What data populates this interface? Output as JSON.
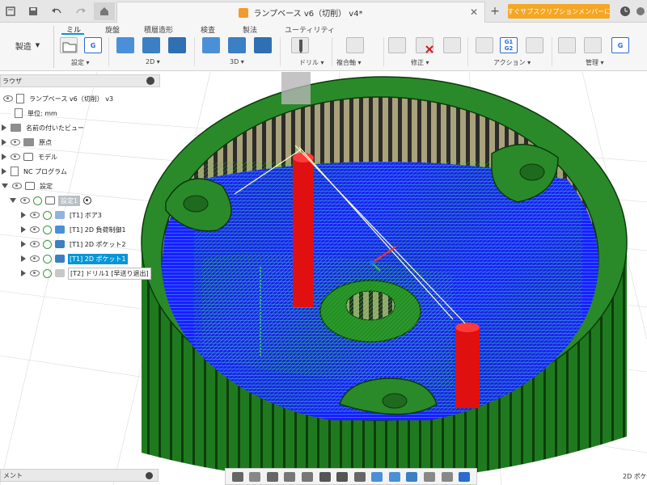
{
  "titlebar": {
    "document_title": "ランプベース v6（切削） v4*",
    "subscribe_label": "今すぐサブスクリプションメンバーに..."
  },
  "ribbon": {
    "workspace": "製造",
    "tabs": [
      {
        "label": "ミル",
        "active": true
      },
      {
        "label": "旋盤"
      },
      {
        "label": "積層造形"
      },
      {
        "label": "検査"
      },
      {
        "label": "製法"
      },
      {
        "label": "ユーティリティ"
      }
    ],
    "groups": [
      "設定",
      "2D",
      "3D",
      "ドリル",
      "複合軸",
      "修正",
      "アクション",
      "管理"
    ],
    "g_icon_labels": [
      "G",
      "G1",
      "G2"
    ]
  },
  "browser": {
    "title": "ラウザ",
    "items": [
      {
        "label": "ランプベース v6（切削） v3"
      },
      {
        "label": "単位: mm"
      },
      {
        "label": "名前の付いたビュー"
      },
      {
        "label": "原点"
      },
      {
        "label": "モデル"
      },
      {
        "label": "NC プログラム"
      },
      {
        "label": "設定"
      },
      {
        "label": "設定1"
      },
      {
        "label": "[T1] ボア3"
      },
      {
        "label": "[T1] 2D 負荷制御1"
      },
      {
        "label": "[T1] 2D ポケット2"
      },
      {
        "label": "[T1] 2D ポケット1"
      },
      {
        "label": "[T2] ドリル1 [早送り退出]"
      }
    ]
  },
  "bottom": {
    "comments_label": "メント",
    "status_right": "2D ポケ"
  },
  "colors": {
    "accent": "#0696d7",
    "part_green": "#2a8a2a",
    "toolpath_blue": "#1a1aff",
    "drill_red": "#e01010",
    "subscribe_orange": "#f5a623"
  }
}
